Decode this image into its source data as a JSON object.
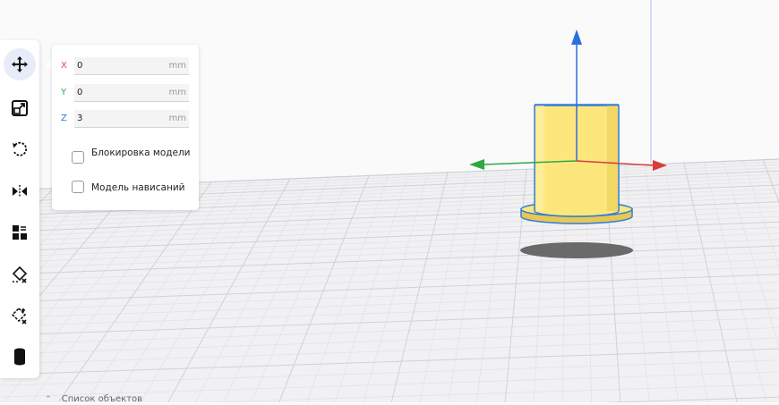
{
  "toolbar": {
    "tools": [
      {
        "name": "move",
        "icon": "move-arrows-icon",
        "active": true
      },
      {
        "name": "scale",
        "icon": "scale-icon",
        "active": false
      },
      {
        "name": "rotate",
        "icon": "rotate-icon",
        "active": false
      },
      {
        "name": "mirror",
        "icon": "mirror-icon",
        "active": false
      },
      {
        "name": "per-model-settings",
        "icon": "per-model-settings-icon",
        "active": false
      },
      {
        "name": "support-blocker",
        "icon": "support-blocker-icon",
        "active": false
      },
      {
        "name": "custom-supports",
        "icon": "custom-supports-icon",
        "active": false
      },
      {
        "name": "cylinder",
        "icon": "cylinder-icon",
        "active": false
      }
    ]
  },
  "move_panel": {
    "x": {
      "label": "X",
      "value": "0",
      "unit": "mm",
      "color": "#d84a45"
    },
    "y": {
      "label": "Y",
      "value": "0",
      "unit": "mm",
      "color": "#2da84a"
    },
    "z": {
      "label": "Z",
      "value": "3",
      "unit": "mm",
      "color": "#3277d3"
    },
    "lock_model": {
      "label": "Блокировка модели",
      "checked": false
    },
    "drop_model": {
      "label": "Модель нависаний",
      "checked": false
    }
  },
  "bottom_bar": {
    "label": "Список объектов",
    "icon": "chevron-up-icon"
  },
  "colors": {
    "model": "#fde77c",
    "model_outline": "#2e7de0",
    "axis_x": "#d83c3c",
    "axis_y": "#2fa844",
    "axis_z": "#2a6fe0"
  }
}
